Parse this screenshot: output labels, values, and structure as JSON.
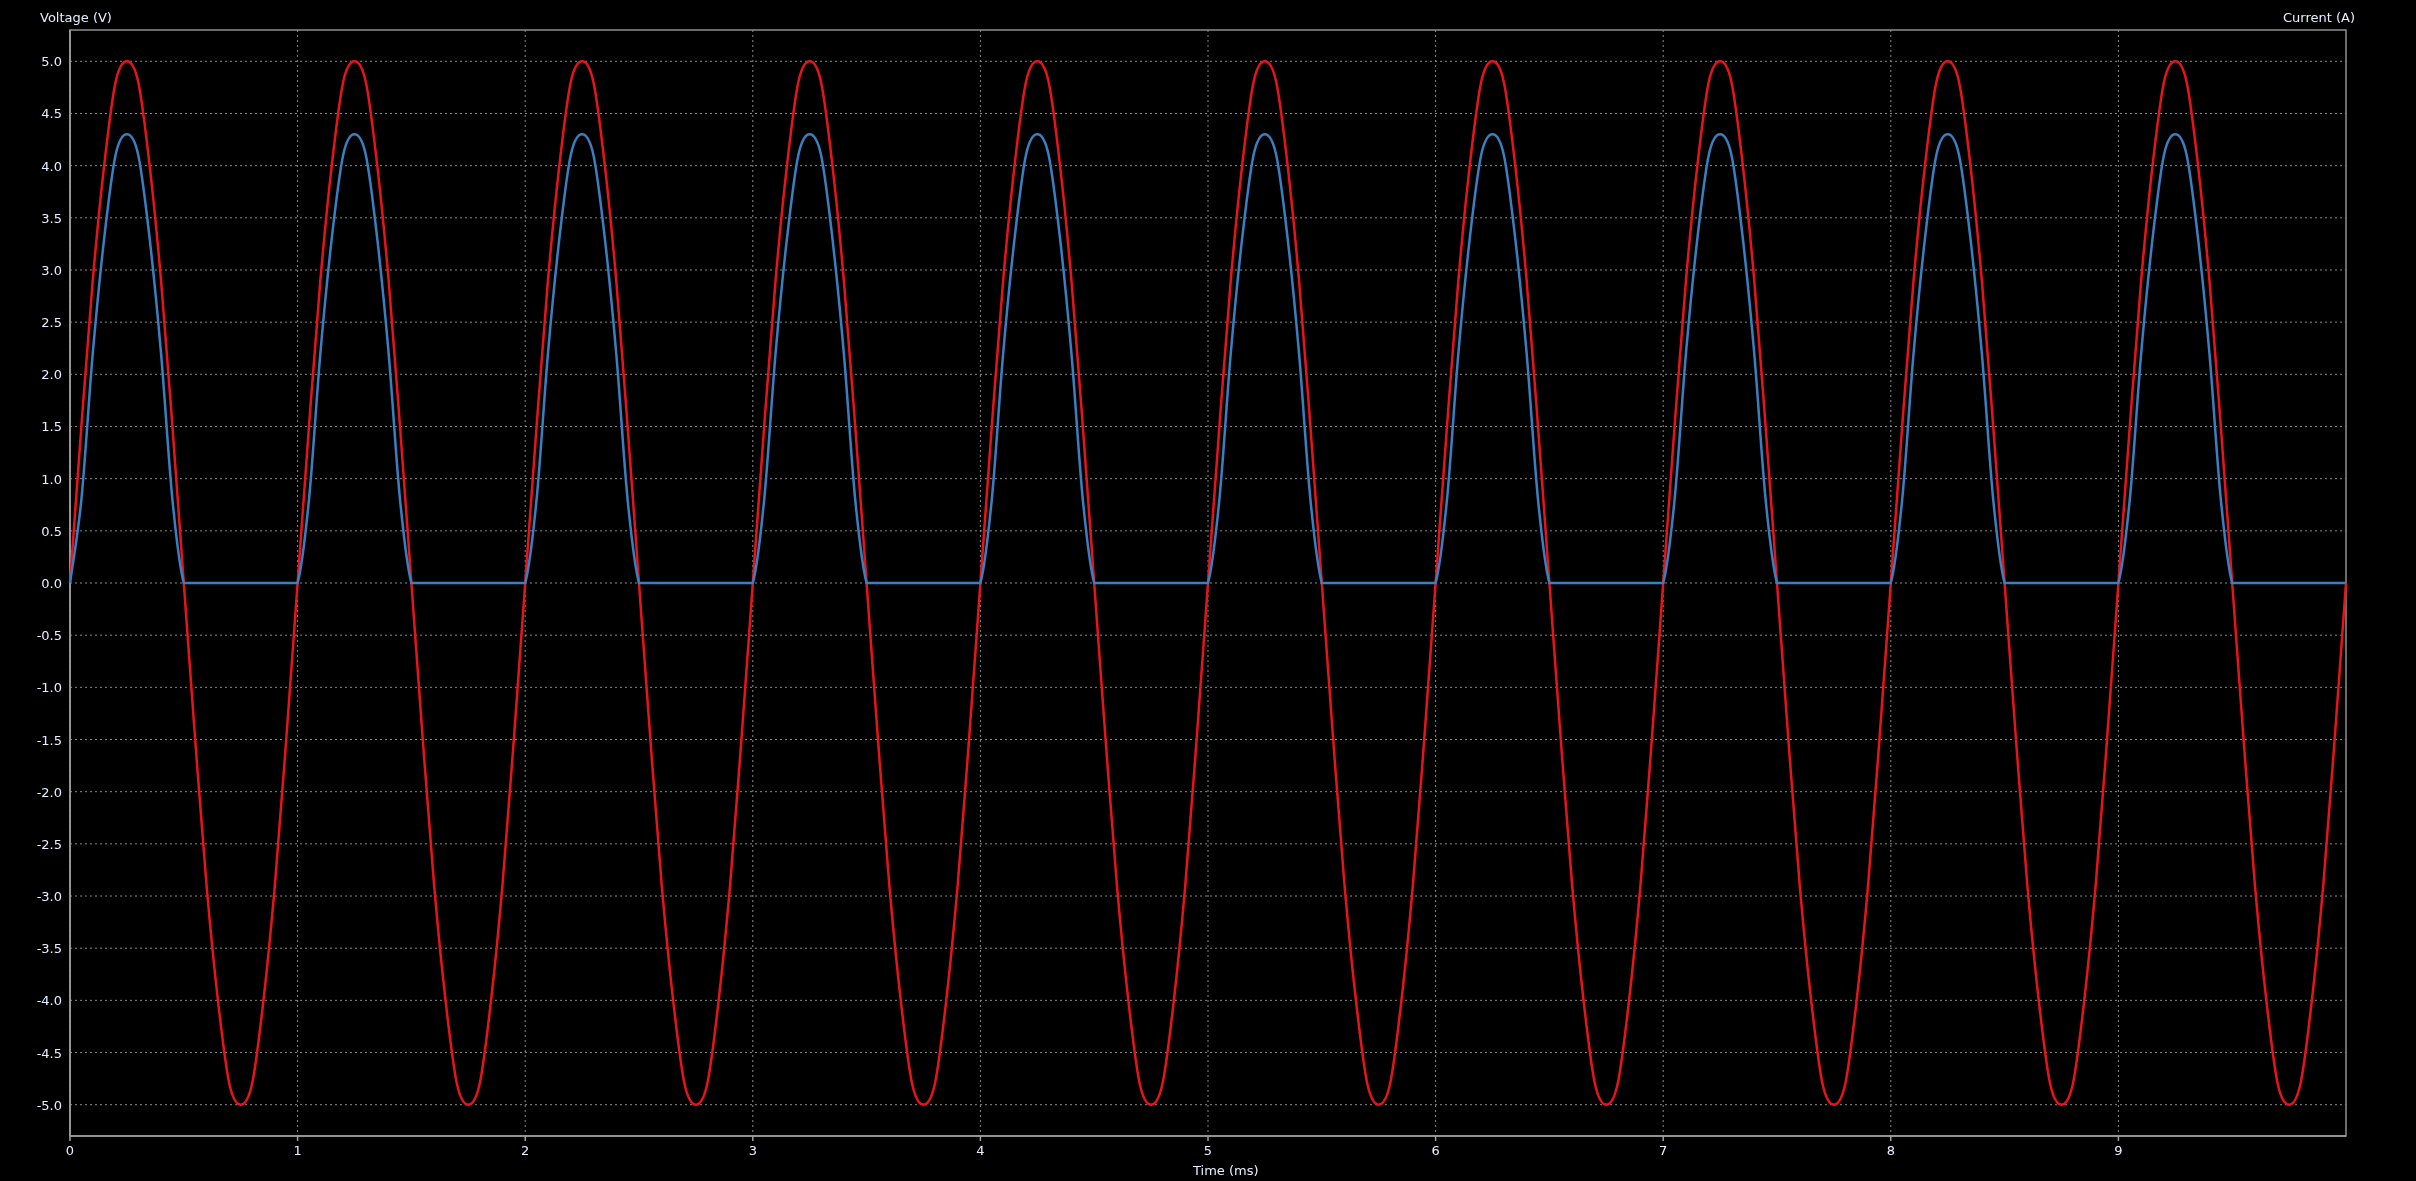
{
  "chart": {
    "secondary_ylabel": "Current (A)",
    "chart_data": {
      "type": "line",
      "grid": true,
      "xlabel": "Time (ms)",
      "ylabel": "Voltage (V)",
      "x": [
        0,
        0.05,
        0.1,
        0.15,
        0.2,
        0.25,
        0.3,
        0.35,
        0.4,
        0.45,
        0.5,
        0.55,
        0.6,
        0.65,
        0.7,
        0.75,
        0.8,
        0.85,
        0.9,
        0.95,
        1,
        1.05,
        1.1,
        1.15,
        1.2,
        1.25,
        1.3,
        1.35,
        1.4,
        1.45,
        1.5,
        1.55,
        1.6,
        1.65,
        1.7,
        1.75,
        1.8,
        1.85,
        1.9,
        1.95,
        2,
        2.05,
        2.1,
        2.15,
        2.2,
        2.25,
        2.3,
        2.35,
        2.4,
        2.45,
        2.5,
        2.55,
        2.6,
        2.65,
        2.7,
        2.75,
        2.8,
        2.85,
        2.9,
        2.95,
        3,
        3.05,
        3.1,
        3.15,
        3.2,
        3.25,
        3.3,
        3.35,
        3.4,
        3.45,
        3.5,
        3.55,
        3.6,
        3.65,
        3.7,
        3.75,
        3.8,
        3.85,
        3.9,
        3.95,
        4,
        4.05,
        4.1,
        4.15,
        4.2,
        4.25,
        4.3,
        4.35,
        4.4,
        4.45,
        4.5,
        4.55,
        4.6,
        4.65,
        4.7,
        4.75,
        4.8,
        4.85,
        4.9,
        4.95,
        5,
        5.05,
        5.1,
        5.15,
        5.2,
        5.25,
        5.3,
        5.35,
        5.4,
        5.45,
        5.5,
        5.55,
        5.6,
        5.65,
        5.7,
        5.75,
        5.8,
        5.85,
        5.9,
        5.95,
        6,
        6.05,
        6.1,
        6.15,
        6.2,
        6.25,
        6.3,
        6.35,
        6.4,
        6.45,
        6.5,
        6.55,
        6.6,
        6.65,
        6.7,
        6.75,
        6.8,
        6.85,
        6.9,
        6.95,
        7,
        7.05,
        7.1,
        7.15,
        7.2,
        7.25,
        7.3,
        7.35,
        7.4,
        7.45,
        7.5,
        7.55,
        7.6,
        7.65,
        7.7,
        7.75,
        7.8,
        7.85,
        7.9,
        7.95,
        8,
        8.05,
        8.1,
        8.15,
        8.2,
        8.25,
        8.3,
        8.35,
        8.4,
        8.45,
        8.5,
        8.55,
        8.6,
        8.65,
        8.7,
        8.75,
        8.8,
        8.85,
        8.9,
        8.95,
        9,
        9.05,
        9.1,
        9.15,
        9.2,
        9.25,
        9.3,
        9.35,
        9.4,
        9.45,
        9.5,
        9.55,
        9.6,
        9.65,
        9.7,
        9.75,
        9.8,
        9.85,
        9.9,
        9.95,
        10
      ],
      "series": [
        {
          "color": "#e8141c",
          "values": [
            0,
            1.5,
            2.9,
            4,
            4.8,
            5,
            4.8,
            4,
            2.9,
            1.5,
            0,
            -1.5,
            -2.9,
            -4,
            -4.8,
            -5,
            -4.8,
            -4,
            -2.9,
            -1.5,
            0,
            1.5,
            2.9,
            4,
            4.8,
            5,
            4.8,
            4,
            2.9,
            1.5,
            0,
            -1.5,
            -2.9,
            -4,
            -4.8,
            -5,
            -4.8,
            -4,
            -2.9,
            -1.5,
            0,
            1.5,
            2.9,
            4,
            4.8,
            5,
            4.8,
            4,
            2.9,
            1.5,
            0,
            -1.5,
            -2.9,
            -4,
            -4.8,
            -5,
            -4.8,
            -4,
            -2.9,
            -1.5,
            0,
            1.5,
            2.9,
            4,
            4.8,
            5,
            4.8,
            4,
            2.9,
            1.5,
            0,
            -1.5,
            -2.9,
            -4,
            -4.8,
            -5,
            -4.8,
            -4,
            -2.9,
            -1.5,
            0,
            1.5,
            2.9,
            4,
            4.8,
            5,
            4.8,
            4,
            2.9,
            1.5,
            0,
            -1.5,
            -2.9,
            -4,
            -4.8,
            -5,
            -4.8,
            -4,
            -2.9,
            -1.5,
            0,
            1.5,
            2.9,
            4,
            4.8,
            5,
            4.8,
            4,
            2.9,
            1.5,
            0,
            -1.5,
            -2.9,
            -4,
            -4.8,
            -5,
            -4.8,
            -4,
            -2.9,
            -1.5,
            0,
            1.5,
            2.9,
            4,
            4.8,
            5,
            4.8,
            4,
            2.9,
            1.5,
            0,
            -1.5,
            -2.9,
            -4,
            -4.8,
            -5,
            -4.8,
            -4,
            -2.9,
            -1.5,
            0,
            1.5,
            2.9,
            4,
            4.8,
            5,
            4.8,
            4,
            2.9,
            1.5,
            0,
            -1.5,
            -2.9,
            -4,
            -4.8,
            -5,
            -4.8,
            -4,
            -2.9,
            -1.5,
            0,
            1.5,
            2.9,
            4,
            4.8,
            5,
            4.8,
            4,
            2.9,
            1.5,
            0,
            -1.5,
            -2.9,
            -4,
            -4.8,
            -5,
            -4.8,
            -4,
            -2.9,
            -1.5,
            0,
            1.5,
            2.9,
            4,
            4.8,
            5,
            4.8,
            4,
            2.9,
            1.5,
            0,
            -1.5,
            -2.9,
            -4,
            -4.8,
            -5,
            -4.8,
            -4,
            -2.9,
            -1.5,
            0
          ]
        },
        {
          "color": "#3a7fc1",
          "values": [
            0,
            0.8,
            2.2,
            3.3,
            4.1,
            4.3,
            4.1,
            3.3,
            2.2,
            0.8,
            0,
            0,
            0,
            0,
            0,
            0,
            0,
            0,
            0,
            0,
            0,
            0.8,
            2.2,
            3.3,
            4.1,
            4.3,
            4.1,
            3.3,
            2.2,
            0.8,
            0,
            0,
            0,
            0,
            0,
            0,
            0,
            0,
            0,
            0,
            0,
            0.8,
            2.2,
            3.3,
            4.1,
            4.3,
            4.1,
            3.3,
            2.2,
            0.8,
            0,
            0,
            0,
            0,
            0,
            0,
            0,
            0,
            0,
            0,
            0,
            0.8,
            2.2,
            3.3,
            4.1,
            4.3,
            4.1,
            3.3,
            2.2,
            0.8,
            0,
            0,
            0,
            0,
            0,
            0,
            0,
            0,
            0,
            0,
            0,
            0.8,
            2.2,
            3.3,
            4.1,
            4.3,
            4.1,
            3.3,
            2.2,
            0.8,
            0,
            0,
            0,
            0,
            0,
            0,
            0,
            0,
            0,
            0,
            0,
            0.8,
            2.2,
            3.3,
            4.1,
            4.3,
            4.1,
            3.3,
            2.2,
            0.8,
            0,
            0,
            0,
            0,
            0,
            0,
            0,
            0,
            0,
            0,
            0,
            0.8,
            2.2,
            3.3,
            4.1,
            4.3,
            4.1,
            3.3,
            2.2,
            0.8,
            0,
            0,
            0,
            0,
            0,
            0,
            0,
            0,
            0,
            0,
            0,
            0.8,
            2.2,
            3.3,
            4.1,
            4.3,
            4.1,
            3.3,
            2.2,
            0.8,
            0,
            0,
            0,
            0,
            0,
            0,
            0,
            0,
            0,
            0,
            0,
            0.8,
            2.2,
            3.3,
            4.1,
            4.3,
            4.1,
            3.3,
            2.2,
            0.8,
            0,
            0,
            0,
            0,
            0,
            0,
            0,
            0,
            0,
            0,
            0,
            0.8,
            2.2,
            3.3,
            4.1,
            4.3,
            4.1,
            3.3,
            2.2,
            0.8,
            0,
            0,
            0,
            0,
            0,
            0,
            0,
            0,
            0,
            0,
            0
          ]
        }
      ],
      "xlim": [
        0,
        10
      ],
      "ylim": [
        -5.3,
        5.3
      ],
      "xticks": [
        0,
        1,
        2,
        3,
        4,
        5,
        6,
        7,
        8,
        9
      ],
      "yticks": [
        {
          "value": 5,
          "label": "5.0"
        },
        {
          "value": 4.5,
          "label": "4.5"
        },
        {
          "value": 4,
          "label": "4.0"
        },
        {
          "value": 3.5,
          "label": "3.5"
        },
        {
          "value": 3,
          "label": "3.0"
        },
        {
          "value": 2.5,
          "label": "2.5"
        },
        {
          "value": 2,
          "label": "2.0"
        },
        {
          "value": 1.5,
          "label": "1.5"
        },
        {
          "value": 1,
          "label": "1.0"
        },
        {
          "value": 0.5,
          "label": "0.5"
        },
        {
          "value": 0,
          "label": "0.0"
        },
        {
          "value": -0.5,
          "label": "-0.5"
        },
        {
          "value": -1,
          "label": "-1.0"
        },
        {
          "value": -1.5,
          "label": "-1.5"
        },
        {
          "value": -2,
          "label": "-2.0"
        },
        {
          "value": -2.5,
          "label": "-2.5"
        },
        {
          "value": -3,
          "label": "-3.0"
        },
        {
          "value": -3.5,
          "label": "-3.5"
        },
        {
          "value": -4,
          "label": "-4.0"
        },
        {
          "value": -4.5,
          "label": "-4.5"
        },
        {
          "value": -5,
          "label": "-5.0"
        }
      ]
    }
  }
}
